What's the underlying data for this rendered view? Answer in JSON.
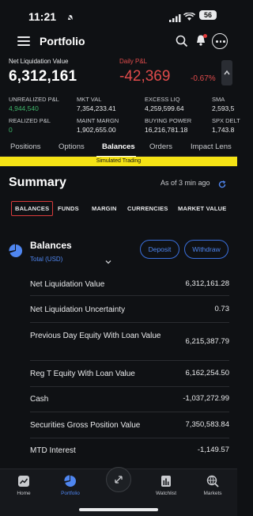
{
  "status": {
    "time": "11:21",
    "battery": "56"
  },
  "header": {
    "title": "Portfolio"
  },
  "net_liq": {
    "label": "Net Liquidation Value",
    "value": "6,312,161"
  },
  "daily_pnl": {
    "label": "Daily P&L",
    "value": "-42,369",
    "pct": "-0.67%"
  },
  "metrics": {
    "unrealized_label": "UNREALIZED P&L",
    "unrealized_value": "4,944,540",
    "mkt_val_label": "MKT VAL",
    "mkt_val_value": "7,354,233.41",
    "excess_liq_label": "EXCESS LIQ",
    "excess_liq_value": "4,259,599.64",
    "sma_label": "SMA",
    "sma_value": "2,593,5",
    "realized_label": "REALIZED P&L",
    "realized_value": "0",
    "maint_label": "MAINT MARGN",
    "maint_value": "1,902,655.00",
    "buying_label": "BUYING POWER",
    "buying_value": "16,216,781.18",
    "spx_label": "SPX DELT",
    "spx_value": "1,743.8"
  },
  "tabs": [
    "Positions",
    "Options",
    "Balances",
    "Orders",
    "Impact Lens"
  ],
  "sim_banner": "Simulated Trading",
  "summary": {
    "title": "Summary",
    "as_of": "As of 3 min ago"
  },
  "subtabs": [
    "BALANCES",
    "FUNDS",
    "MARGIN",
    "CURRENCIES",
    "MARKET VALUE"
  ],
  "balances": {
    "title": "Balances",
    "subtitle": "Total (USD)",
    "deposit": "Deposit",
    "withdraw": "Withdraw",
    "rows": [
      {
        "label": "Net Liquidation Value",
        "value": "6,312,161.28"
      },
      {
        "label": "Net Liquidation Uncertainty",
        "value": "0.73"
      },
      {
        "label": "Previous Day Equity With Loan Value",
        "value": "6,215,387.79"
      },
      {
        "label": "Reg T Equity With Loan Value",
        "value": "6,162,254.50"
      },
      {
        "label": "Cash",
        "value": "-1,037,272.99"
      },
      {
        "label": "Securities Gross Position Value",
        "value": "7,350,583.84"
      },
      {
        "label": "MTD Interest",
        "value": "-1,149.57"
      }
    ]
  },
  "bottom_nav": [
    "Home",
    "Portfolio",
    "Watchlist",
    "Markets"
  ],
  "colors": {
    "accent": "#4f86f0",
    "loss": "#e04b4b",
    "gain": "#3fb56a",
    "banner": "#f5e315"
  }
}
